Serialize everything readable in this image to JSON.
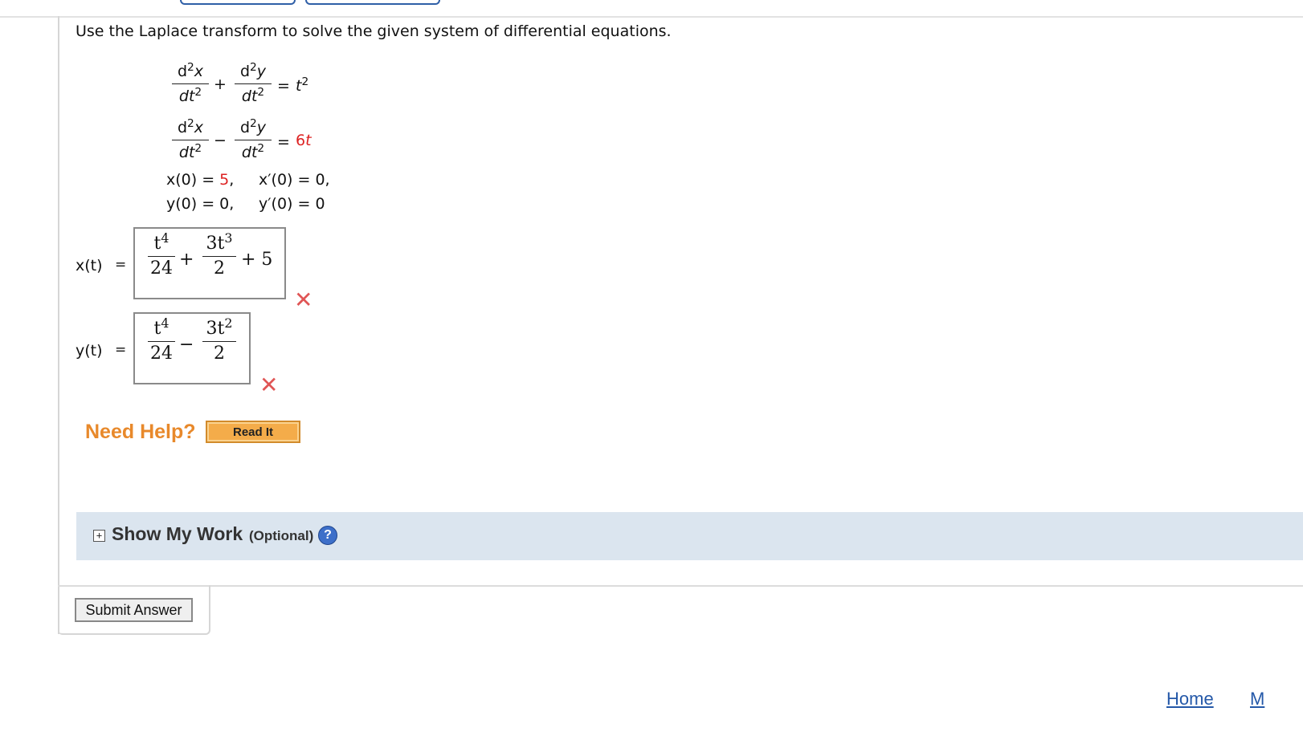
{
  "question": {
    "prompt": "Use the Laplace transform to solve the given system of differential equations."
  },
  "equations": {
    "d2x": "d",
    "num_x": "x",
    "num_y": "y",
    "den": "dt",
    "sq": "2",
    "op1": "+",
    "op2": "−",
    "eq": "=",
    "rhs1_base": "t",
    "rhs1_exp": "2",
    "rhs2": "6",
    "rhs2_var": "t",
    "ic_x0": "x(0) = ",
    "ic_x0_val": "5",
    "ic_x0_tail": ",",
    "ic_xp0": "x′(0) = 0,",
    "ic_y0": "y(0) = 0,",
    "ic_yp0": "y′(0) = 0"
  },
  "answers": {
    "x_label": "x(t)",
    "y_label": "y(t)",
    "eq_sign": "=",
    "x_answer": {
      "t": "t",
      "p4": "4",
      "d24": "24",
      "plus": "+",
      "c3": "3",
      "p3": "3",
      "d2": "2",
      "tail": "+ 5"
    },
    "y_answer": {
      "t": "t",
      "p4": "4",
      "d24": "24",
      "minus": "−",
      "c3": "3",
      "p2": "2",
      "d2": "2"
    },
    "incorrect_mark": "✕"
  },
  "help": {
    "need_help": "Need Help?",
    "read_it": "Read It"
  },
  "show_my_work": {
    "toggle": "+",
    "title": "Show My Work",
    "optional": "(Optional)",
    "help_icon": "?"
  },
  "actions": {
    "submit": "Submit Answer"
  },
  "footer": {
    "home": "Home",
    "next": "M"
  }
}
